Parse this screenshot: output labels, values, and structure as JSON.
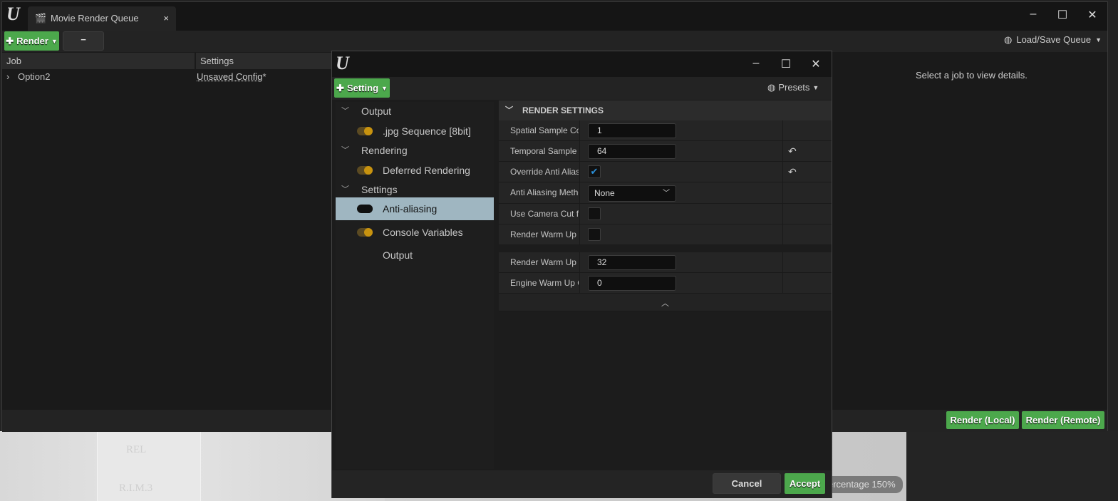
{
  "main_window": {
    "tab_title": "Movie Render Queue",
    "toolbar": {
      "render_label": "Render",
      "remove_label": "−",
      "load_save_label": "Load/Save Queue"
    },
    "table": {
      "headers": [
        "Job",
        "Settings"
      ],
      "rows": [
        {
          "job": "Option2",
          "settings": "Unsaved Config",
          "modified": "*"
        }
      ]
    },
    "details_placeholder": "Select a job to view details.",
    "render_local_label": "Render (Local)",
    "render_remote_label": "Render (Remote)"
  },
  "dialog": {
    "setting_label": "Setting",
    "presets_label": "Presets",
    "tree": [
      {
        "label": "Output",
        "type": "category"
      },
      {
        "label": ".jpg Sequence [8bit]",
        "type": "item",
        "enabled": true
      },
      {
        "label": "Rendering",
        "type": "category"
      },
      {
        "label": "Deferred Rendering",
        "type": "item",
        "enabled": true
      },
      {
        "label": "Settings",
        "type": "category"
      },
      {
        "label": "Anti-aliasing",
        "type": "item",
        "enabled": false,
        "selected": true
      },
      {
        "label": "Console Variables",
        "type": "item",
        "enabled": true
      },
      {
        "label": "Output",
        "type": "item"
      }
    ],
    "section_title": "RENDER SETTINGS",
    "properties": [
      {
        "label": "Spatial Sample Count",
        "value": "1"
      },
      {
        "label": "Temporal Sample Count",
        "value": "64"
      },
      {
        "label": "Override Anti Aliasing",
        "checked": true
      },
      {
        "label": "Anti Aliasing Method",
        "value": "None"
      },
      {
        "label": "Use Camera Cut for Warm Up",
        "checked": false
      },
      {
        "label": "Render Warm Up Frames",
        "checked": false
      },
      {
        "label": "Render Warm Up Count",
        "value": "32"
      },
      {
        "label": "Engine Warm Up Count",
        "value": "0"
      }
    ],
    "cancel_label": "Cancel",
    "accept_label": "Accept"
  },
  "background": {
    "viewport_overlay": "ercentage  150%",
    "viewport_text": [
      "REL",
      "R.I.M.3"
    ]
  }
}
